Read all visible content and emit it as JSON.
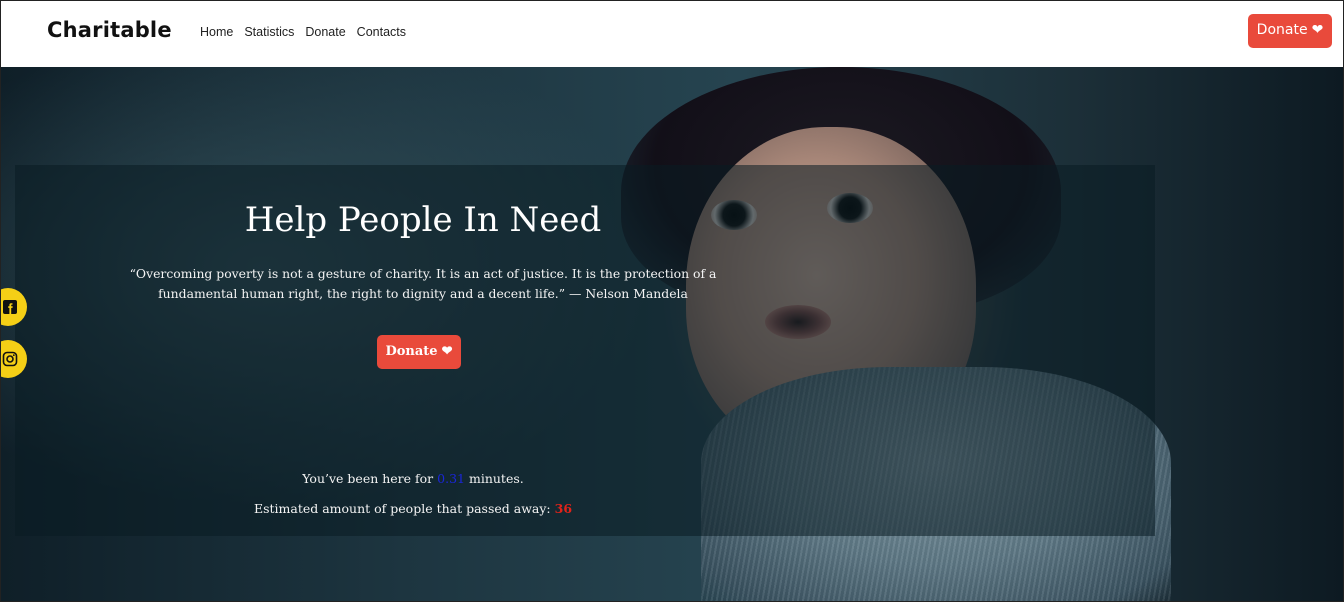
{
  "navbar": {
    "brand": "Charitable",
    "links": [
      "Home",
      "Statistics",
      "Donate",
      "Contacts"
    ],
    "donate_label": "Donate",
    "donate_icon": "heart-icon"
  },
  "hero": {
    "title": "Help People In Need",
    "quote": "“Overcoming poverty is not a gesture of charity. It is an act of justice. It is the protection of a fundamental human right, the right to dignity and a decent life.” — Nelson Mandela",
    "donate_label": "Donate",
    "donate_icon": "heart-icon",
    "time_prefix": "You’ve been here for",
    "time_value": "0.31",
    "time_suffix": "minutes.",
    "death_prefix": "Estimated amount of people that passed away:",
    "death_value": "36"
  },
  "social": {
    "facebook_icon": "facebook-icon",
    "instagram_icon": "instagram-icon"
  },
  "colors": {
    "accent": "#e94a3b",
    "social_bg": "#f5cf16",
    "time_value": "#1a26d8",
    "death_value": "#e0231a"
  }
}
